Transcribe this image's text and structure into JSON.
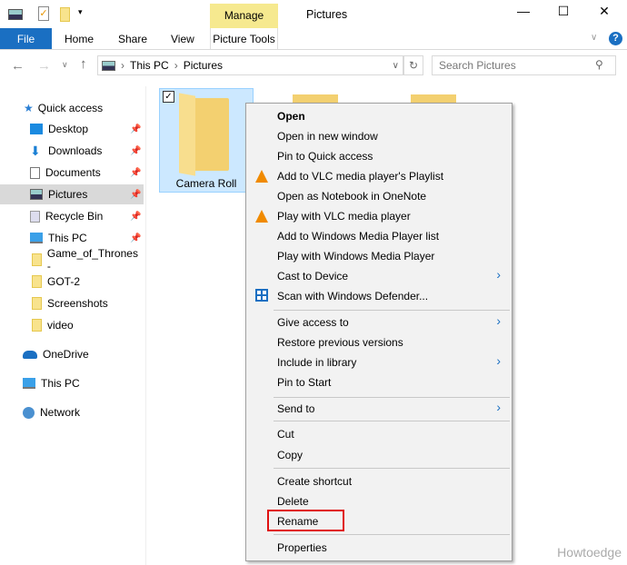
{
  "window": {
    "title": "Pictures",
    "contextual_group": "Manage",
    "contextual_tab": "Picture Tools"
  },
  "ribbon": {
    "tabs": [
      "File",
      "Home",
      "Share",
      "View"
    ]
  },
  "address": {
    "crumbs": [
      "This PC",
      "Pictures"
    ]
  },
  "search": {
    "placeholder": "Search Pictures"
  },
  "sidebar": {
    "quick_access": "Quick access",
    "items": [
      {
        "label": "Desktop",
        "pinned": true
      },
      {
        "label": "Downloads",
        "pinned": true
      },
      {
        "label": "Documents",
        "pinned": true
      },
      {
        "label": "Pictures",
        "pinned": true,
        "selected": true
      },
      {
        "label": "Recycle Bin",
        "pinned": true
      },
      {
        "label": "This PC",
        "pinned": true
      },
      {
        "label": "Game_of_Thrones -"
      },
      {
        "label": "GOT-2"
      },
      {
        "label": "Screenshots"
      },
      {
        "label": "video"
      }
    ],
    "roots": [
      "OneDrive",
      "This PC",
      "Network"
    ]
  },
  "files": [
    {
      "name": "Camera Roll",
      "selected": true
    }
  ],
  "context_menu": {
    "items": [
      "Open",
      "Open in new window",
      "Pin to Quick access",
      "Add to VLC media player's Playlist",
      "Open as Notebook in OneNote",
      "Play with VLC media player",
      "Add to Windows Media Player list",
      "Play with Windows Media Player",
      "Cast to Device",
      "Scan with Windows Defender...",
      "Give access to",
      "Restore previous versions",
      "Include in library",
      "Pin to Start",
      "Send to",
      "Cut",
      "Copy",
      "Create shortcut",
      "Delete",
      "Rename",
      "Properties"
    ],
    "highlighted": "Rename"
  },
  "watermark": "Howtoedge",
  "colors": {
    "accent": "#1a6fc2",
    "manage": "#f6e98f",
    "highlight": "#e01010"
  }
}
